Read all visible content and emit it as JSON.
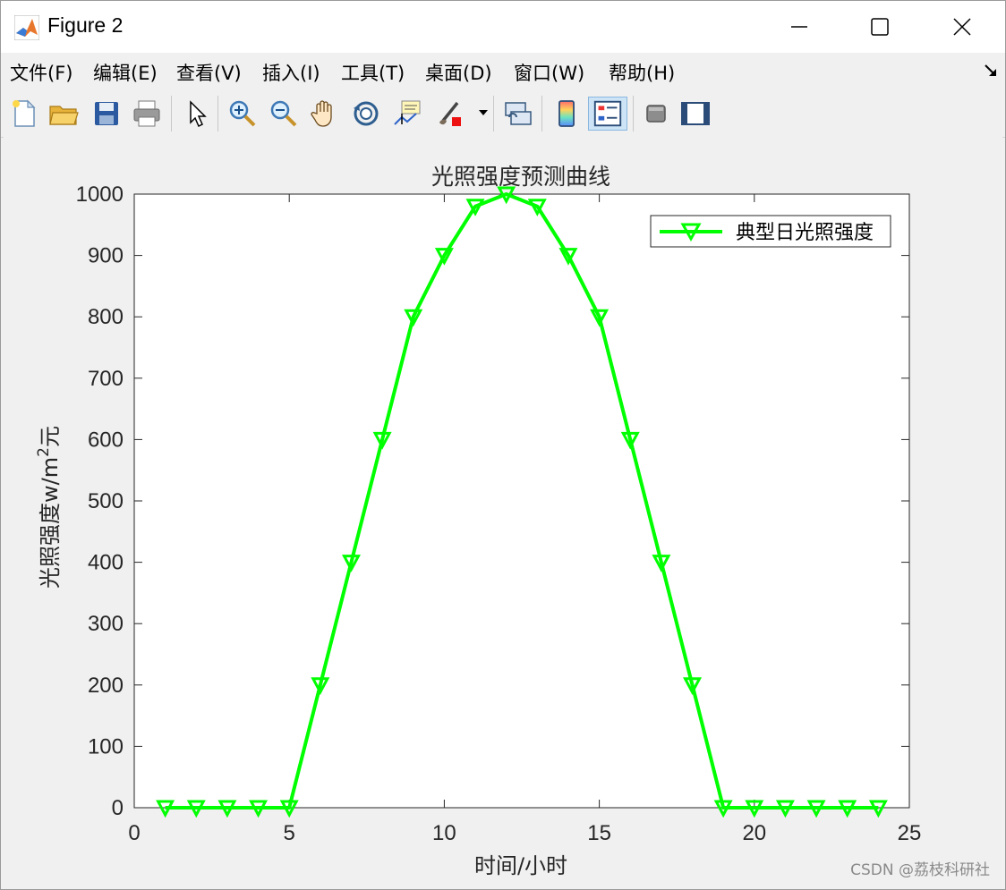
{
  "window": {
    "title": "Figure 2"
  },
  "menu": {
    "items": [
      {
        "label": "文件(F)"
      },
      {
        "label": "编辑(E)"
      },
      {
        "label": "查看(V)"
      },
      {
        "label": "插入(I)"
      },
      {
        "label": "工具(T)"
      },
      {
        "label": "桌面(D)"
      },
      {
        "label": "窗口(W)"
      },
      {
        "label": "帮助(H)"
      }
    ]
  },
  "toolbar": {
    "icons": [
      "new-figure-icon",
      "open-folder-icon",
      "save-icon",
      "print-icon",
      "pointer-icon",
      "zoom-in-icon",
      "zoom-out-icon",
      "pan-hand-icon",
      "rotate-3d-icon",
      "data-cursor-icon",
      "brush-icon",
      "link-plot-icon",
      "colorbar-icon",
      "legend-icon",
      "hide-plot-tools-icon",
      "show-plot-tools-icon"
    ]
  },
  "colors": {
    "line": "#00ff00",
    "axes_bg": "#ffffff",
    "figure_bg": "#f0f0f0"
  },
  "chart_data": {
    "type": "line",
    "title": "光照强度预测曲线",
    "xlabel": "时间/小时",
    "ylabel_main": "光照强度w/m",
    "ylabel_sup": "2",
    "ylabel_tail": "元",
    "xlim": [
      0,
      25
    ],
    "ylim": [
      0,
      1000
    ],
    "xticks": [
      "0",
      "5",
      "10",
      "15",
      "20",
      "25"
    ],
    "yticks": [
      "0",
      "100",
      "200",
      "300",
      "400",
      "500",
      "600",
      "700",
      "800",
      "900",
      "1000"
    ],
    "grid": false,
    "legend_position": "top-right",
    "series": [
      {
        "name": "典型日光照强度",
        "marker": "down-triangle",
        "x": [
          1,
          2,
          3,
          4,
          5,
          6,
          7,
          8,
          9,
          10,
          11,
          12,
          13,
          14,
          15,
          16,
          17,
          18,
          19,
          20,
          21,
          22,
          23,
          24
        ],
        "values": [
          0,
          0,
          0,
          0,
          0,
          200,
          400,
          600,
          800,
          900,
          980,
          1000,
          980,
          900,
          800,
          600,
          400,
          200,
          0,
          0,
          0,
          0,
          0,
          0
        ]
      }
    ]
  },
  "watermark": "CSDN @荔枝科研社"
}
